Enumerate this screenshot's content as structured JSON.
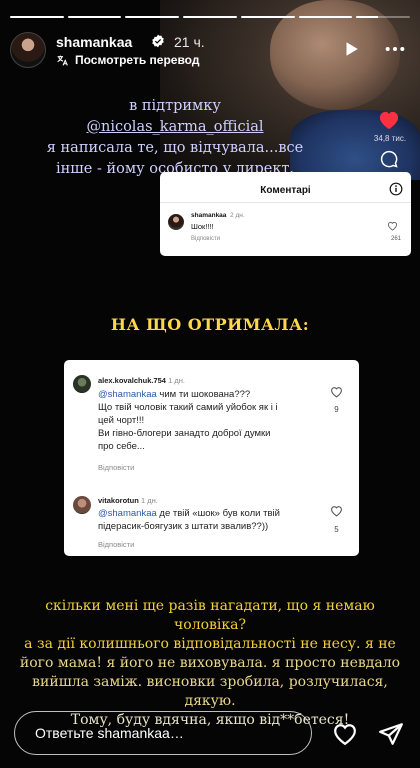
{
  "progress": [
    1,
    1,
    1,
    1,
    1,
    1,
    0.4
  ],
  "header": {
    "username": "shamankaa",
    "time": "21 ч.",
    "translate_label": "Посмотреть перевод"
  },
  "rail": {
    "like_count": "34,8 тис."
  },
  "overlay_top": {
    "line1_prefix": "в підтримку ",
    "mention": "@nicolas_karma_official",
    "line2": "я написала те, що відчувала...все",
    "line3": "інше - йому особисто у директ."
  },
  "card1": {
    "title": "Коментарі",
    "username": "shamankaa",
    "time": "2 дн.",
    "text": "Шок!!!!",
    "reply": "Відповісти",
    "likes": "261"
  },
  "heading": "НА ЩО ОТРИМАЛА:",
  "card2": {
    "comments": [
      {
        "username": "alex.kovalchuk.754",
        "time": "1 дн.",
        "mention": "@shamankaa",
        "lines": [
          " чим ти шокована???",
          "Що твій чоловік такий самий уйобок як і і",
          "цей чорт!!!",
          "Ви гівно-блогери занадто доброї думки",
          "про себе..."
        ],
        "reply": "Відповісти",
        "likes": "9"
      },
      {
        "username": "vitakorotun",
        "time": "1 дн.",
        "mention": "@shamankaa",
        "lines": [
          " де твій «шок» був коли твій",
          "підерасик-боягузик з штати звалив??))"
        ],
        "reply": "Відповісти",
        "likes": "5"
      }
    ]
  },
  "bottom_text": {
    "line1": "скільки мені ще разів нагадати, що я немаю чоловіка?",
    "line2": "а за дії колишнього відповідальності не несу. я не",
    "line3": "його мама! я його не виховувала. я просто невдало",
    "line4": "вийшла заміж. висновки зробила, розлучилася, дякую.",
    "line5": "Тому, буду вдячна, якщо від**бетеся!"
  },
  "footer": {
    "reply_placeholder": "Ответьте shamankaa…"
  }
}
